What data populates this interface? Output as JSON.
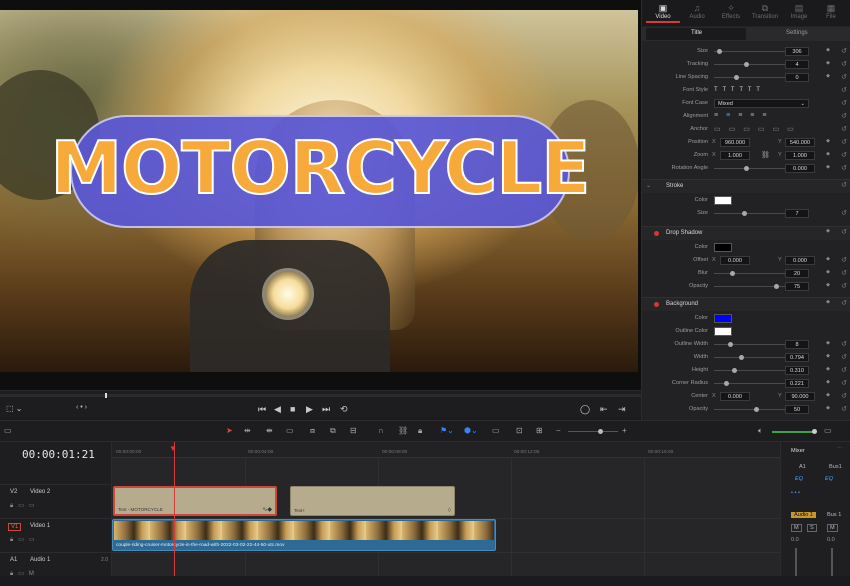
{
  "viewer": {
    "title_text": "MOTORCYCLE"
  },
  "transport": {
    "icons": [
      "safe-area-icon",
      "prev-frame-icon",
      "play-icon",
      "stop-icon",
      "play-icon",
      "next-icon",
      "loop-icon",
      "full-screen-icon",
      "next-frame-icon",
      "skip-end-icon"
    ],
    "marker": "‹ • ›"
  },
  "inspector": {
    "tabs": [
      "Video",
      "Audio",
      "Effects",
      "Transition",
      "Image",
      "File"
    ],
    "subtabs": [
      "Title",
      "Settings"
    ],
    "size": "306",
    "tracking": "4",
    "line_spacing": "0",
    "font_style_glyphs": "T   T   T   T   T   T",
    "font_case": "Mixed",
    "position_x": "960.000",
    "position_y": "540.000",
    "zoom_x": "1.000",
    "zoom_y": "1.000",
    "rotation_angle": "0.000",
    "stroke": {
      "title": "Stroke",
      "color": "#ffffff",
      "size": "7"
    },
    "drop_shadow": {
      "title": "Drop Shadow",
      "color": "#000000",
      "offset_x": "0.000",
      "offset_y": "0.000",
      "blur": "20",
      "opacity": "75"
    },
    "background": {
      "title": "Background",
      "color": "#0000ff",
      "outline_color": "#ffffff",
      "outline_width": "8",
      "width": "0.794",
      "height": "0.310",
      "corner_radius": "0.221",
      "center_x": "0.000",
      "center_y": "90.000",
      "opacity": "50"
    },
    "labels": {
      "size": "Size",
      "tracking": "Tracking",
      "line_spacing": "Line Spacing",
      "font_style": "Font Style",
      "font_case": "Font Case",
      "alignment": "Alignment",
      "anchor": "Anchor",
      "position": "Position",
      "zoom": "Zoom",
      "rotation": "Rotation Angle",
      "color": "Color",
      "offset": "Offset",
      "blur": "Blur",
      "opacity": "Opacity",
      "outline_color": "Outline Color",
      "outline_width": "Outline Width",
      "width": "Width",
      "height": "Height",
      "corner_radius": "Corner Radius",
      "center": "Center",
      "x": "X",
      "y": "Y"
    }
  },
  "timeline": {
    "timecode": "00:00:01:21",
    "ruler": [
      "00:00:00:00",
      "00:00:04:00",
      "00:00:08:00",
      "00:00:12:00",
      "00:00:16:00"
    ],
    "tracks": [
      {
        "id": "V2",
        "name": "Video 2"
      },
      {
        "id": "V1",
        "name": "Video 1"
      },
      {
        "id": "A1",
        "name": "Audio 1",
        "level": "2.0"
      }
    ],
    "clips": {
      "title_a": "Text - MOTORCYCLE",
      "title_b": "Text+",
      "video": "couple-riding-cruiser-motorcycle-in-the-road-with-2022-03-02-22-44-50-utc.mov"
    }
  },
  "mixer": {
    "title": "Mixer",
    "a1": "A1",
    "bus1": "Bus1",
    "audio1": "Audio 1",
    "bus1b": "Bus 1",
    "eq": "EQ",
    "val": "0.0"
  }
}
